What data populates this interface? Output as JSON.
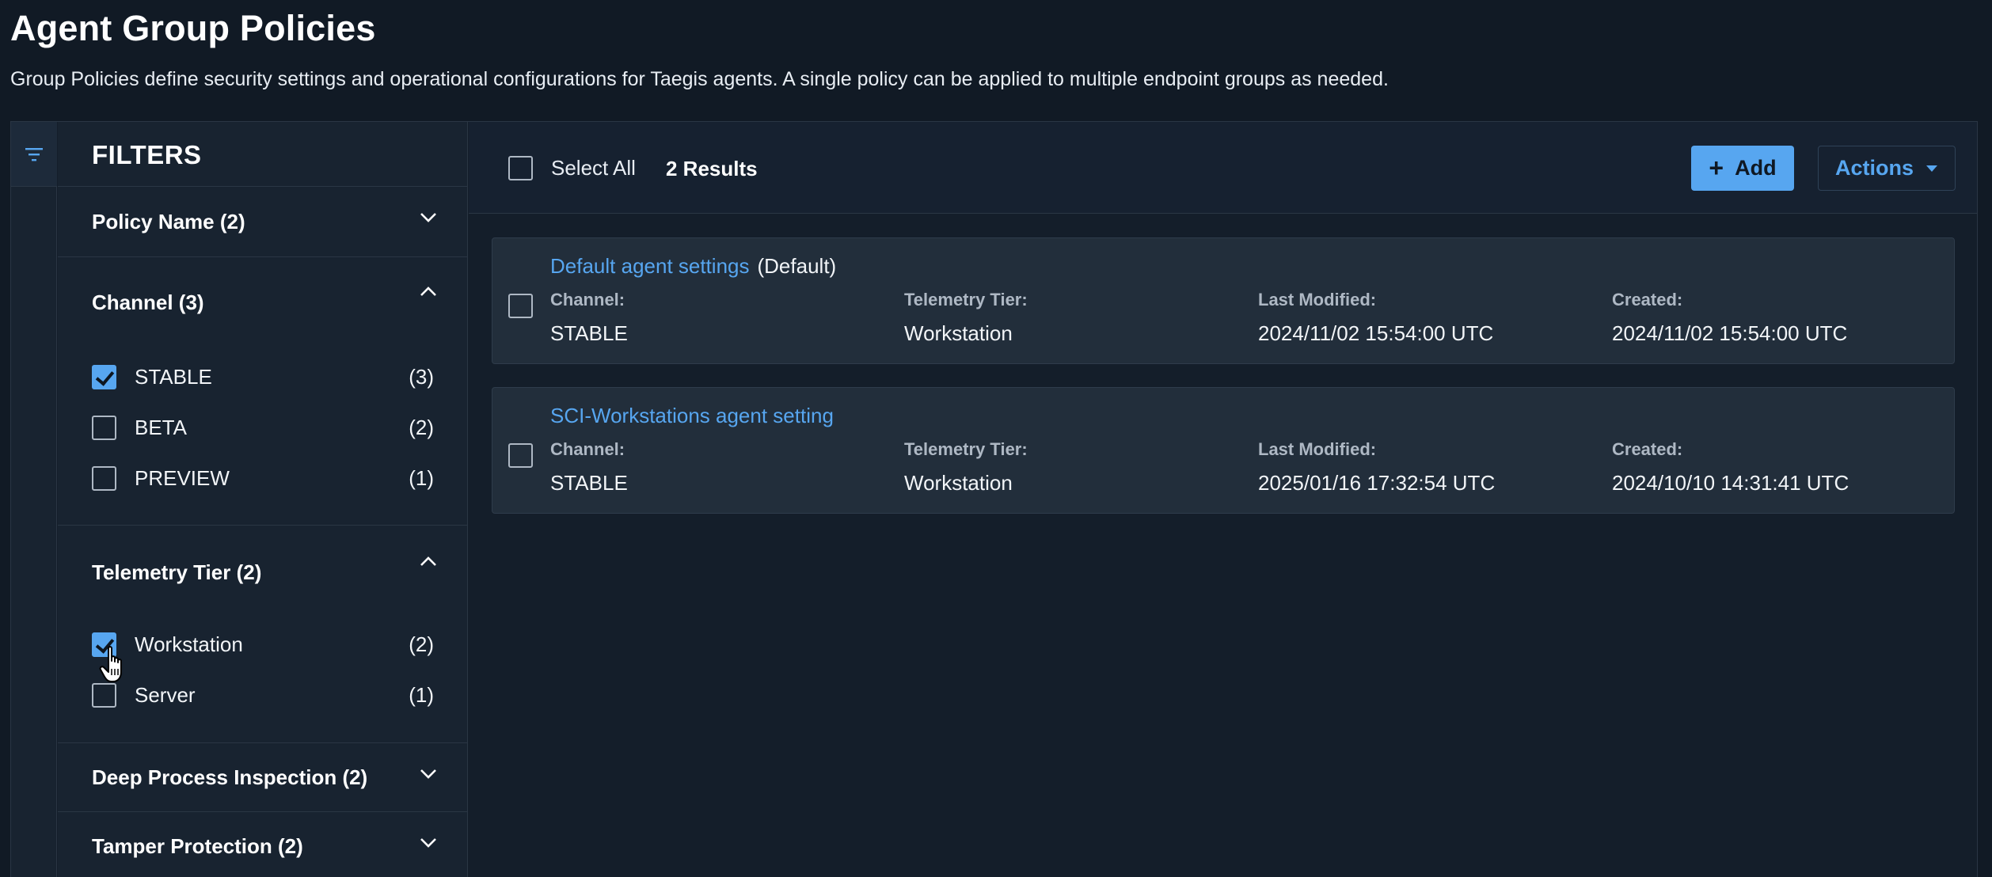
{
  "page": {
    "title": "Agent Group Policies",
    "description": "Group Policies define security settings and operational configurations for Taegis agents. A single policy can be applied to multiple endpoint groups as needed."
  },
  "filters": {
    "title": "FILTERS",
    "sections": {
      "policy_name": {
        "title": "Policy Name (2)",
        "expanded": false
      },
      "channel": {
        "title": "Channel (3)",
        "expanded": true,
        "options": [
          {
            "label": "STABLE",
            "count": "(3)",
            "checked": true
          },
          {
            "label": "BETA",
            "count": "(2)",
            "checked": false
          },
          {
            "label": "PREVIEW",
            "count": "(1)",
            "checked": false
          }
        ]
      },
      "telemetry_tier": {
        "title": "Telemetry Tier (2)",
        "expanded": true,
        "options": [
          {
            "label": "Workstation",
            "count": "(2)",
            "checked": true
          },
          {
            "label": "Server",
            "count": "(1)",
            "checked": false
          }
        ]
      },
      "deep_process_inspection": {
        "title": "Deep Process Inspection (2)",
        "expanded": false
      },
      "tamper_protection": {
        "title": "Tamper Protection (2)",
        "expanded": false
      }
    }
  },
  "toolbar": {
    "select_all_label": "Select All",
    "results": "2 Results",
    "add_label": "Add",
    "actions_label": "Actions"
  },
  "policies": [
    {
      "name": "Default agent settings",
      "tag": "(Default)",
      "channel_label": "Channel:",
      "channel": "STABLE",
      "tier_label": "Telemetry Tier:",
      "tier": "Workstation",
      "modified_label": "Last Modified:",
      "modified": "2024/11/02 15:54:00 UTC",
      "created_label": "Created:",
      "created": "2024/11/02 15:54:00 UTC"
    },
    {
      "name": "SCI-Workstations agent setting",
      "tag": "",
      "channel_label": "Channel:",
      "channel": "STABLE",
      "tier_label": "Telemetry Tier:",
      "tier": "Workstation",
      "modified_label": "Last Modified:",
      "modified": "2025/01/16 17:32:54 UTC",
      "created_label": "Created:",
      "created": "2024/10/10 14:31:41 UTC"
    }
  ],
  "colors": {
    "accent": "#57a6f0",
    "background": "#111a25"
  },
  "icons": {
    "rail": "filter-icon",
    "collapsed": "chevron-down-icon",
    "expanded": "chevron-up-icon",
    "add": "plus-icon",
    "actions": "caret-down-icon",
    "pointer": "hand-pointer-cursor"
  }
}
